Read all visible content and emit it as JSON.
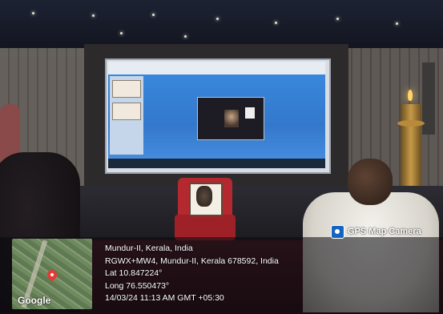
{
  "overlay": {
    "watermark": "GPS Map Camera",
    "map_label": "Google",
    "lines": [
      "Mundur-II, Kerala, India",
      "RGWX+MW4, Mundur-II, Kerala 678592, India",
      "Lat 10.847224°",
      "Long 76.550473°",
      "14/03/24 11:13 AM GMT +05:30"
    ]
  }
}
